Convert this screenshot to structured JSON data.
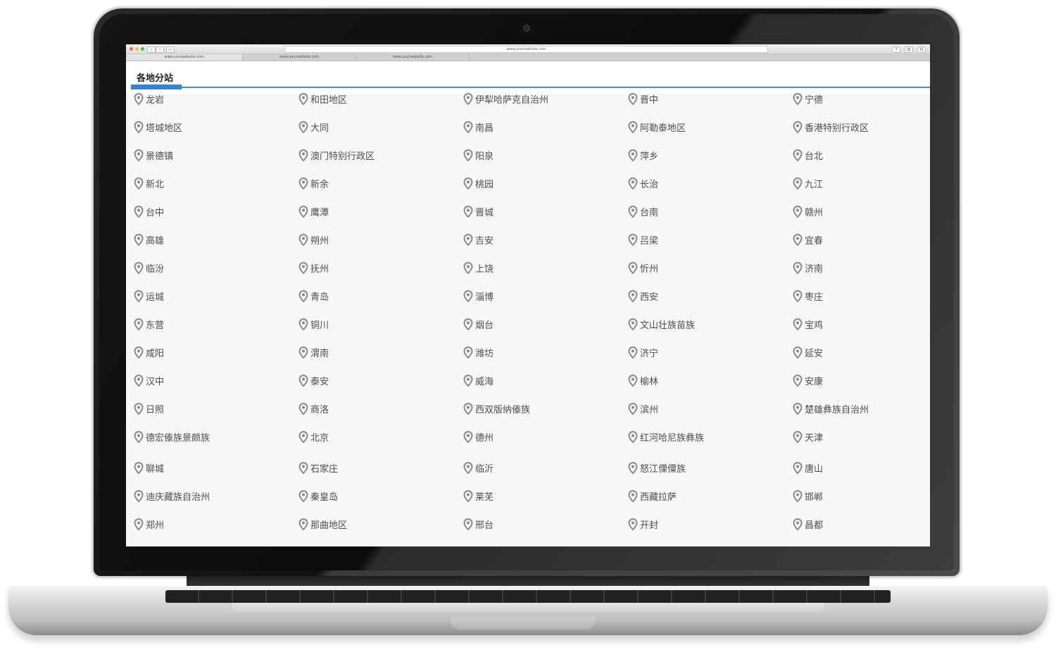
{
  "browser": {
    "url": "www.yourwebsite.com",
    "tabs": [
      "www.yourwebsite.com",
      "www.yourwebsite.com",
      "www.yourwebsite.com"
    ]
  },
  "section": {
    "title": "各地分站"
  },
  "cities": [
    "龙岩",
    "和田地区",
    "伊犁哈萨克自治州",
    "晋中",
    "宁德",
    "塔城地区",
    "大同",
    "南昌",
    "阿勒泰地区",
    "香港特别行政区",
    "景德镇",
    "澳门特别行政区",
    "阳泉",
    "萍乡",
    "台北",
    "新北",
    "新余",
    "桃园",
    "长治",
    "九江",
    "台中",
    "鹰潭",
    "晋城",
    "台南",
    "赣州",
    "高雄",
    "朔州",
    "吉安",
    "吕梁",
    "宜春",
    "临汾",
    "抚州",
    "上饶",
    "忻州",
    "济南",
    "运城",
    "青岛",
    "淄博",
    "西安",
    "枣庄",
    "东营",
    "铜川",
    "烟台",
    "文山壮族苗族",
    "宝鸡",
    "咸阳",
    "渭南",
    "潍坊",
    "济宁",
    "延安",
    "汉中",
    "泰安",
    "威海",
    "榆林",
    "安康",
    "日照",
    "商洛",
    "西双版纳傣族",
    "滨州",
    "楚雄彝族自治州",
    "德宏傣族景颇族",
    "北京",
    "德州",
    "红河哈尼族彝族",
    "天津",
    "聊城",
    "石家庄",
    "临沂",
    "怒江傈僳族",
    "唐山",
    "迪庆藏族自治州",
    "秦皇岛",
    "莱芜",
    "西藏拉萨",
    "邯郸",
    "郑州",
    "那曲地区",
    "邢台",
    "开封",
    "昌都"
  ],
  "colors": {
    "accent": "#2f86d6",
    "link_text": "#4d4d4d",
    "pin_icon": "#8a8a8a",
    "page_bg": "#f7f7f7"
  }
}
